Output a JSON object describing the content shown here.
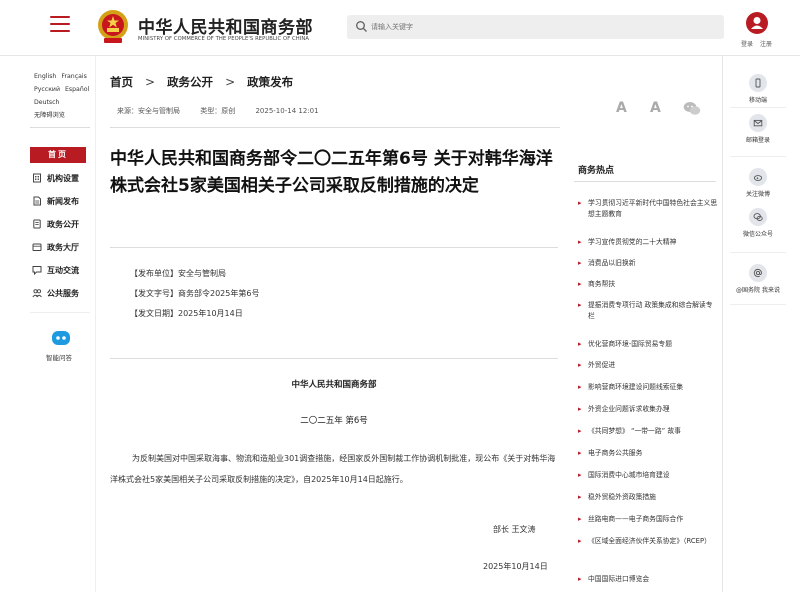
{
  "header": {
    "logo_cn": "中华人民共和国商务部",
    "logo_en": "MINISTRY OF COMMERCE OF THE PEOPLE'S REPUBLIC OF CHINA",
    "search_placeholder": "请输入关键字",
    "login": "登录",
    "register": "注册"
  },
  "languages": [
    [
      "English",
      "Français"
    ],
    [
      "Русский",
      "Español"
    ],
    [
      "Deutsch"
    ],
    [
      "无障碍浏览"
    ]
  ],
  "left_nav": {
    "home": "首页",
    "items": [
      "机构设置",
      "新闻发布",
      "政务公开",
      "政务大厅",
      "互动交流",
      "公共服务"
    ],
    "assistant": "智能问答"
  },
  "breadcrumb": [
    "首页",
    "政务公开",
    "政策发布"
  ],
  "meta": {
    "source": "来源：安全与管制局",
    "type": "类型：原创",
    "date": "2025-10-14 12:01"
  },
  "font_controls": {
    "large": "A",
    "small": "A"
  },
  "article": {
    "title": "中华人民共和国商务部令二〇二五年第6号 关于对韩华海洋株式会社5家美国相关子公司采取反制措施的决定",
    "issuer": "【发布单位】安全与管制局",
    "doc_no": "【发文字号】商务部令2025年第6号",
    "issue_date": "【发文日期】2025年10月14日",
    "org": "中华人民共和国商务部",
    "order_no": "二〇二五年 第6号",
    "body": "为反制美国对中国采取海事、物流和造船业301调查措施，经国家反外国制裁工作协调机制批准，现公布《关于对韩华海洋株式会社5家美国相关子公司采取反制措施的决定》，自2025年10月14日起施行。",
    "signer": "部长 王文涛",
    "sign_date": "2025年10月14日"
  },
  "hot": {
    "title": "商务热点",
    "items": [
      "学习贯彻习近平新时代中国特色社会主义思想主题教育",
      "学习宣传贯彻党的二十大精神",
      "消费品以旧换新",
      "商务帮扶",
      "提振消费专项行动 政策集成和综合解读专栏",
      "优化营商环境-国际贸易专题",
      "外贸促进",
      "影响营商环境建设问题线索征集",
      "外资企业问题诉求收集办理",
      "《共同梦想》 “一带一路” 故事",
      "电子商务公共服务",
      "国际消费中心城市培育建设",
      "稳外贸稳外资政策措施",
      "丝路电商——电子商务国际合作",
      "《区域全面经济伙伴关系协定》（RCEP）",
      "中国国际进口博览会"
    ]
  },
  "right_panel": [
    "移动端",
    "邮箱登录",
    "关注微博",
    "微信公众号",
    "@国务院 我来说"
  ],
  "colors": {
    "brand_red": "#b81c22"
  }
}
